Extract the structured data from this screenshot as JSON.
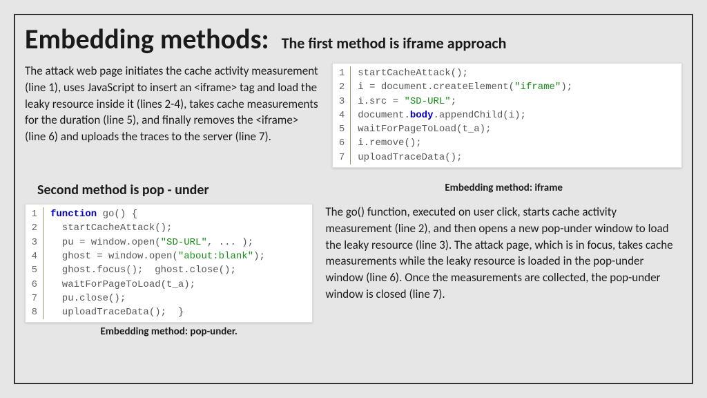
{
  "title": "Embedding methods:",
  "subtitle": "The first method is  iframe approach",
  "para1": "The attack web page initiates the cache activity measurement (line 1), uses JavaScript to insert an <iframe> tag and load the leaky resource inside it (lines 2-4), takes cache measurements for the duration  (line 5), and finally removes the <iframe> (line 6) and uploads the traces to the server (line 7).",
  "code1_caption": "Embedding method: iframe",
  "code1": [
    [
      {
        "t": "startCacheAttack();",
        "c": "fn"
      }
    ],
    [
      {
        "t": "i = document.createElement(",
        "c": "fn"
      },
      {
        "t": "\"iframe\"",
        "c": "str"
      },
      {
        "t": ");",
        "c": "fn"
      }
    ],
    [
      {
        "t": "i.src = ",
        "c": "fn"
      },
      {
        "t": "\"SD-URL\"",
        "c": "str"
      },
      {
        "t": ";",
        "c": "fn"
      }
    ],
    [
      {
        "t": "document.",
        "c": "fn"
      },
      {
        "t": "body",
        "c": "body"
      },
      {
        "t": ".appendChild(i);",
        "c": "fn"
      }
    ],
    [
      {
        "t": "waitForPageToLoad(t_a);",
        "c": "fn"
      }
    ],
    [
      {
        "t": "i.remove();",
        "c": "fn"
      }
    ],
    [
      {
        "t": "uploadTraceData();",
        "c": "fn"
      }
    ]
  ],
  "heading2": "Second method is pop - under",
  "code2_caption": "Embedding method: pop-under.",
  "code2": [
    [
      {
        "t": "function",
        "c": "kw"
      },
      {
        "t": " go() {",
        "c": "fn"
      }
    ],
    [
      {
        "t": "  startCacheAttack();",
        "c": "fn"
      }
    ],
    [
      {
        "t": "  pu = window.open(",
        "c": "fn"
      },
      {
        "t": "\"SD-URL\"",
        "c": "str"
      },
      {
        "t": ", ... );",
        "c": "fn"
      }
    ],
    [
      {
        "t": "  ghost = window.open(",
        "c": "fn"
      },
      {
        "t": "\"about:blank\"",
        "c": "str"
      },
      {
        "t": ");",
        "c": "fn"
      }
    ],
    [
      {
        "t": "  ghost.focus();  ghost.close();",
        "c": "fn"
      }
    ],
    [
      {
        "t": "  waitForPageToLoad(t_a);",
        "c": "fn"
      }
    ],
    [
      {
        "t": "  pu.close();",
        "c": "fn"
      }
    ],
    [
      {
        "t": "  uploadTraceData();  }",
        "c": "fn"
      }
    ]
  ],
  "para2": "The go() function, executed on user click, starts cache activity measurement (line 2), and then opens a new pop-under window to load the leaky resource (line 3). The attack page, which is in focus, takes cache measurements while the leaky resource is loaded in the pop-under window (line 6). Once the measurements are collected, the pop-under window is closed (line 7)."
}
